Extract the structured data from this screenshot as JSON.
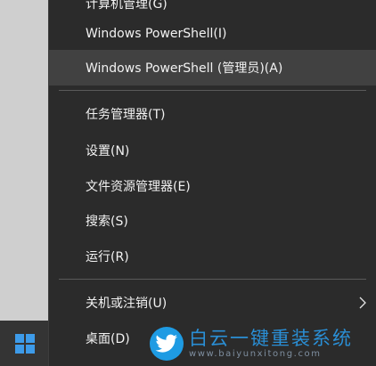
{
  "menu": {
    "items": [
      {
        "label": "计算机管理(G)"
      },
      {
        "label": "Windows PowerShell(I)"
      },
      {
        "label": "Windows PowerShell (管理员)(A)"
      },
      {
        "label": "任务管理器(T)"
      },
      {
        "label": "设置(N)"
      },
      {
        "label": "文件资源管理器(E)"
      },
      {
        "label": "搜索(S)"
      },
      {
        "label": "运行(R)"
      },
      {
        "label": "关机或注销(U)"
      },
      {
        "label": "桌面(D)"
      }
    ]
  },
  "watermark": {
    "title": "白云一键重装系统",
    "url": "www.baiyunxitong.com",
    "logo_icon": "bird-icon"
  },
  "taskbar": {
    "start_icon": "windows-logo-icon"
  },
  "colors": {
    "menu_bg": "#2b2b2b",
    "hover_bg": "#414141",
    "text": "#f2f2f2",
    "accent": "#1e9be3"
  }
}
